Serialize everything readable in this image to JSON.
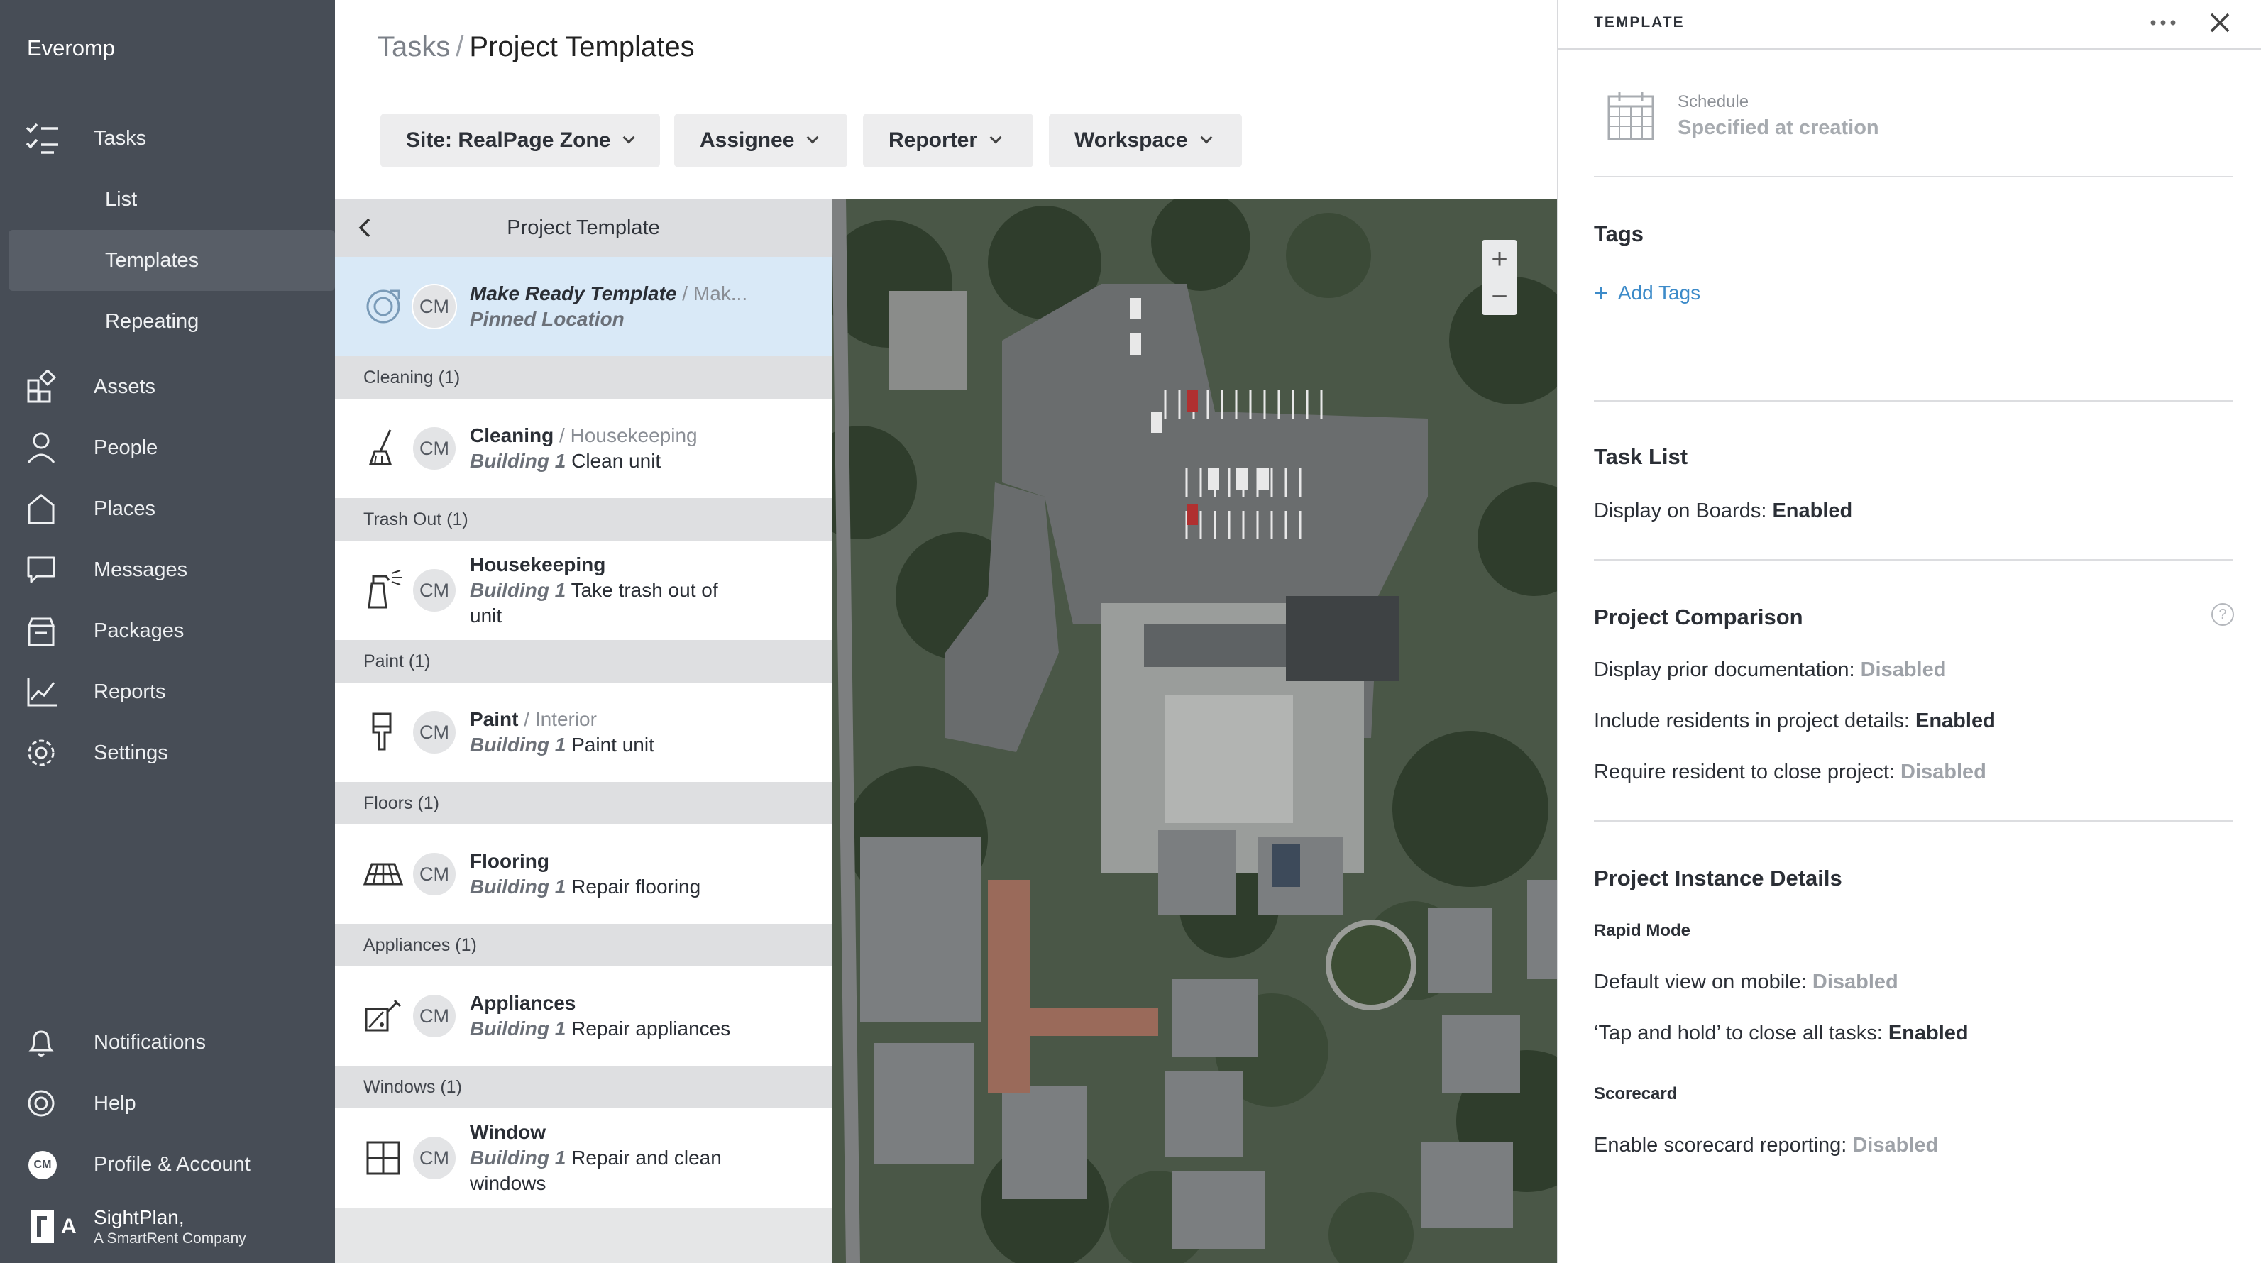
{
  "app": {
    "name": "Everomp"
  },
  "nav": {
    "tasks": "Tasks",
    "list": "List",
    "templates": "Templates",
    "repeating": "Repeating",
    "assets": "Assets",
    "people": "People",
    "places": "Places",
    "messages": "Messages",
    "packages": "Packages",
    "reports": "Reports",
    "settings": "Settings",
    "notifications": "Notifications",
    "help": "Help",
    "profile": "Profile & Account",
    "profile_initials": "CM",
    "brand_line1": "SightPlan,",
    "brand_line2": "A SmartRent Company",
    "brand_mark": "A"
  },
  "breadcrumb": {
    "parent": "Tasks",
    "separator": "/",
    "current": "Project Templates"
  },
  "filters": [
    "Site: RealPage Zone",
    "Assignee",
    "Reporter",
    "Workspace"
  ],
  "list": {
    "header": "Project Template",
    "selected": {
      "title": "Make Ready Template",
      "sep": " / ",
      "cat": "Mak...",
      "sub": "Pinned Location",
      "initials": "CM",
      "icon": "target-icon"
    },
    "groups": [
      {
        "label": "Cleaning (1)",
        "title": "Cleaning",
        "cat": "Housekeeping",
        "building": "Building 1",
        "desc": "Clean unit",
        "desc2": "",
        "initials": "CM",
        "icon": "broom-icon"
      },
      {
        "label": "Trash Out (1)",
        "title": "Housekeeping",
        "cat": "",
        "building": "Building 1",
        "desc": "Take trash out of",
        "desc2": "unit",
        "initials": "CM",
        "icon": "spray-bottle-icon"
      },
      {
        "label": "Paint (1)",
        "title": "Paint",
        "cat": "Interior",
        "building": "Building 1",
        "desc": "Paint unit",
        "desc2": "",
        "initials": "CM",
        "icon": "paint-brush-icon"
      },
      {
        "label": "Floors (1)",
        "title": "Flooring",
        "cat": "",
        "building": "Building 1",
        "desc": "Repair flooring",
        "desc2": "",
        "initials": "CM",
        "icon": "flooring-icon"
      },
      {
        "label": "Appliances (1)",
        "title": "Appliances",
        "cat": "",
        "building": "Building 1",
        "desc": "Repair appliances",
        "desc2": "",
        "initials": "CM",
        "icon": "appliance-icon"
      },
      {
        "label": "Windows (1)",
        "title": "Window",
        "cat": "",
        "building": "Building 1",
        "desc": "Repair and clean",
        "desc2": "windows",
        "initials": "CM",
        "icon": "window-icon"
      }
    ]
  },
  "map": {
    "zoom_in": "+",
    "zoom_out": "−"
  },
  "panel": {
    "title": "TEMPLATE",
    "schedule_label": "Schedule",
    "schedule_value": "Specified at creation",
    "tags_heading": "Tags",
    "add_tags": "Add Tags",
    "tasklist_heading": "Task List",
    "display_boards": "Display on Boards:",
    "display_boards_val": "Enabled",
    "comparison_heading": "Project Comparison",
    "prior_doc": "Display prior documentation:",
    "prior_doc_val": "Disabled",
    "include_res": "Include residents in project details:",
    "include_res_val": "Enabled",
    "require_res": "Require resident to close project:",
    "require_res_val": "Disabled",
    "instance_heading": "Project Instance Details",
    "rapid_mode": "Rapid Mode",
    "default_view": "Default view on mobile:",
    "default_view_val": "Disabled",
    "tap_hold": "‘Tap and hold’ to close all tasks:",
    "tap_hold_val": "Enabled",
    "scorecard": "Scorecard",
    "scorecard_rep": "Enable scorecard reporting:",
    "scorecard_rep_val": "Disabled",
    "help_glyph": "?"
  }
}
